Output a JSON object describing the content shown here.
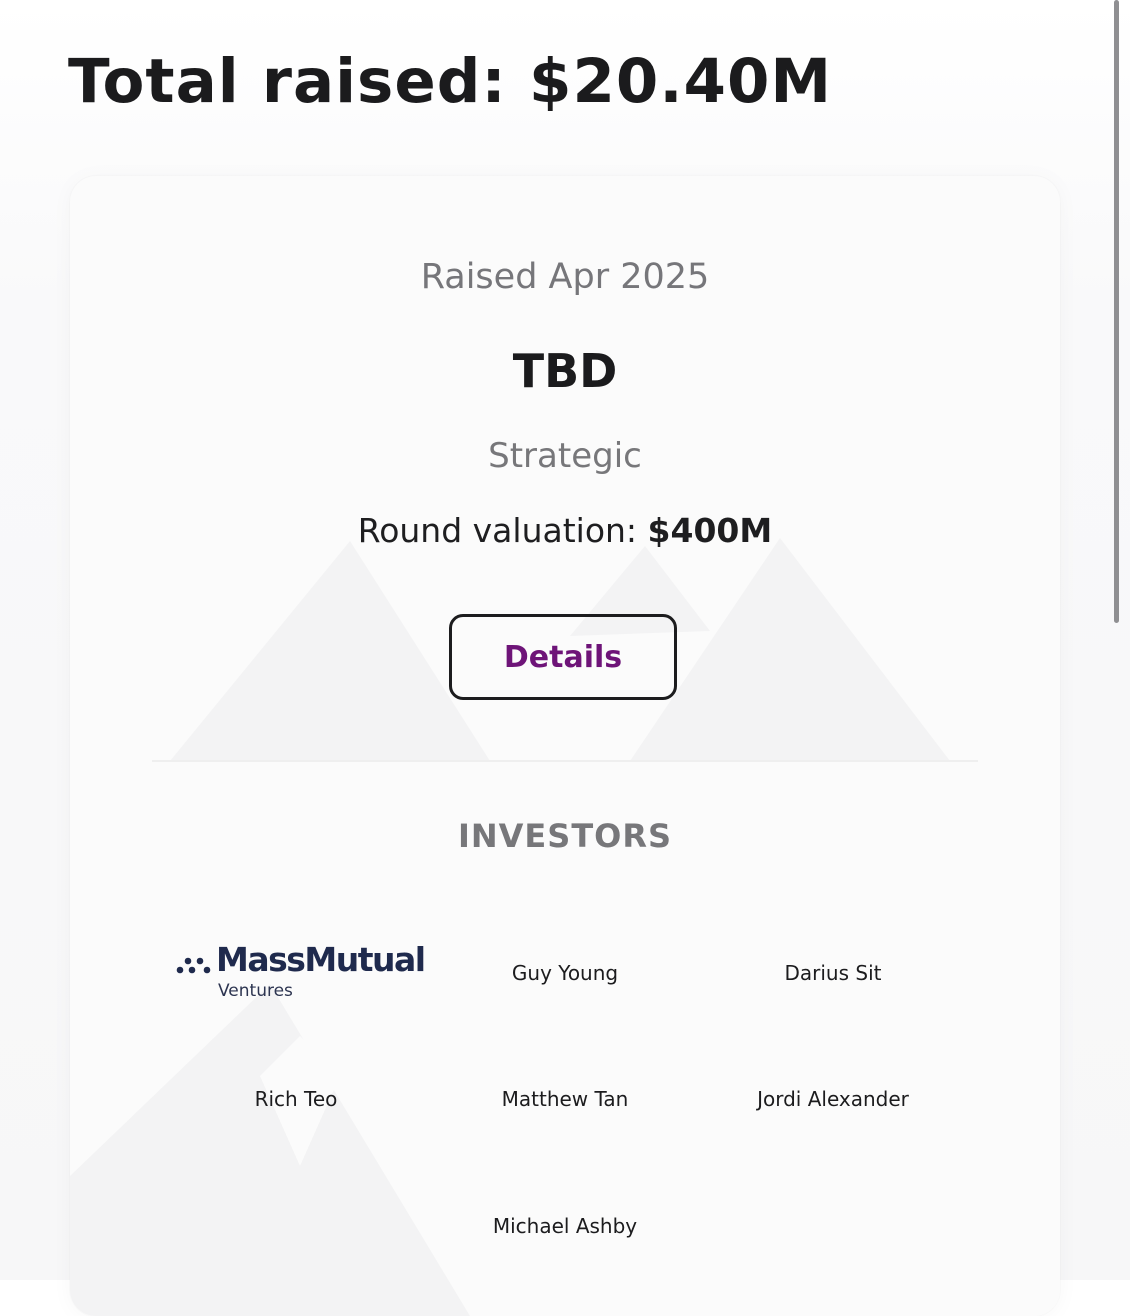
{
  "funding": {
    "total_label": "Total raised: $20.40M"
  },
  "round": {
    "date_label": "Raised Apr 2025",
    "name": "TBD",
    "type": "Strategic",
    "valuation_label": "Round valuation:",
    "valuation_value": "$400M",
    "details_button": "Details"
  },
  "investors": {
    "heading": "INVESTORS",
    "logo": {
      "name": "MassMutual",
      "subtitle": "Ventures",
      "icon": "massmutual-dots-logo",
      "color": "#1f2a4d"
    },
    "people": [
      "Guy Young",
      "Darius Sit",
      "Rich Teo",
      "Matthew Tan",
      "Jordi Alexander",
      "Michael Ashby"
    ]
  },
  "colors": {
    "accent": "#6e1478",
    "text": "#1b1b1d",
    "muted": "#77777a"
  }
}
